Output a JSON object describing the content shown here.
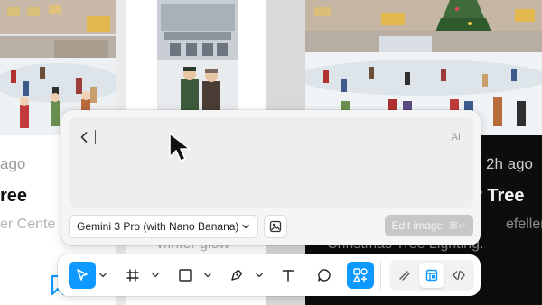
{
  "background": {
    "left_card": {
      "time_fragment": "ago",
      "title_fragment": "ree",
      "subtitle_fragment": "er Cente"
    },
    "center_card": {
      "text_fragment": "winter glow"
    },
    "right_card": {
      "time": "2h ago",
      "title_fragment": "r Tree",
      "subtitle_fragment_1": "efeller C",
      "subtitle_fragment_2": "Christmas Tree Lighting."
    }
  },
  "ai_panel": {
    "badge": "AI",
    "prompt_value": "",
    "model_label": "Gemini 3 Pro (with Nano Banana)",
    "edit_button_label": "Edit image",
    "edit_button_shortcut": "⌘↵"
  },
  "toolbar": {
    "tools": [
      "move-tool",
      "frame-tool",
      "shape-tool",
      "pen-tool",
      "text-tool",
      "comment-tool",
      "actions-tool"
    ],
    "active_tools": [
      "move-tool",
      "actions-tool"
    ],
    "modes": [
      "draw-mode",
      "design-mode",
      "dev-mode"
    ],
    "selected_mode": "design-mode",
    "accent_color": "#0d99ff"
  },
  "colors": {
    "panel_bg": "#f5f5f5",
    "accent": "#0d99ff",
    "dark_card": "#0d0d0d",
    "disabled_button": "#c7c7c7"
  }
}
